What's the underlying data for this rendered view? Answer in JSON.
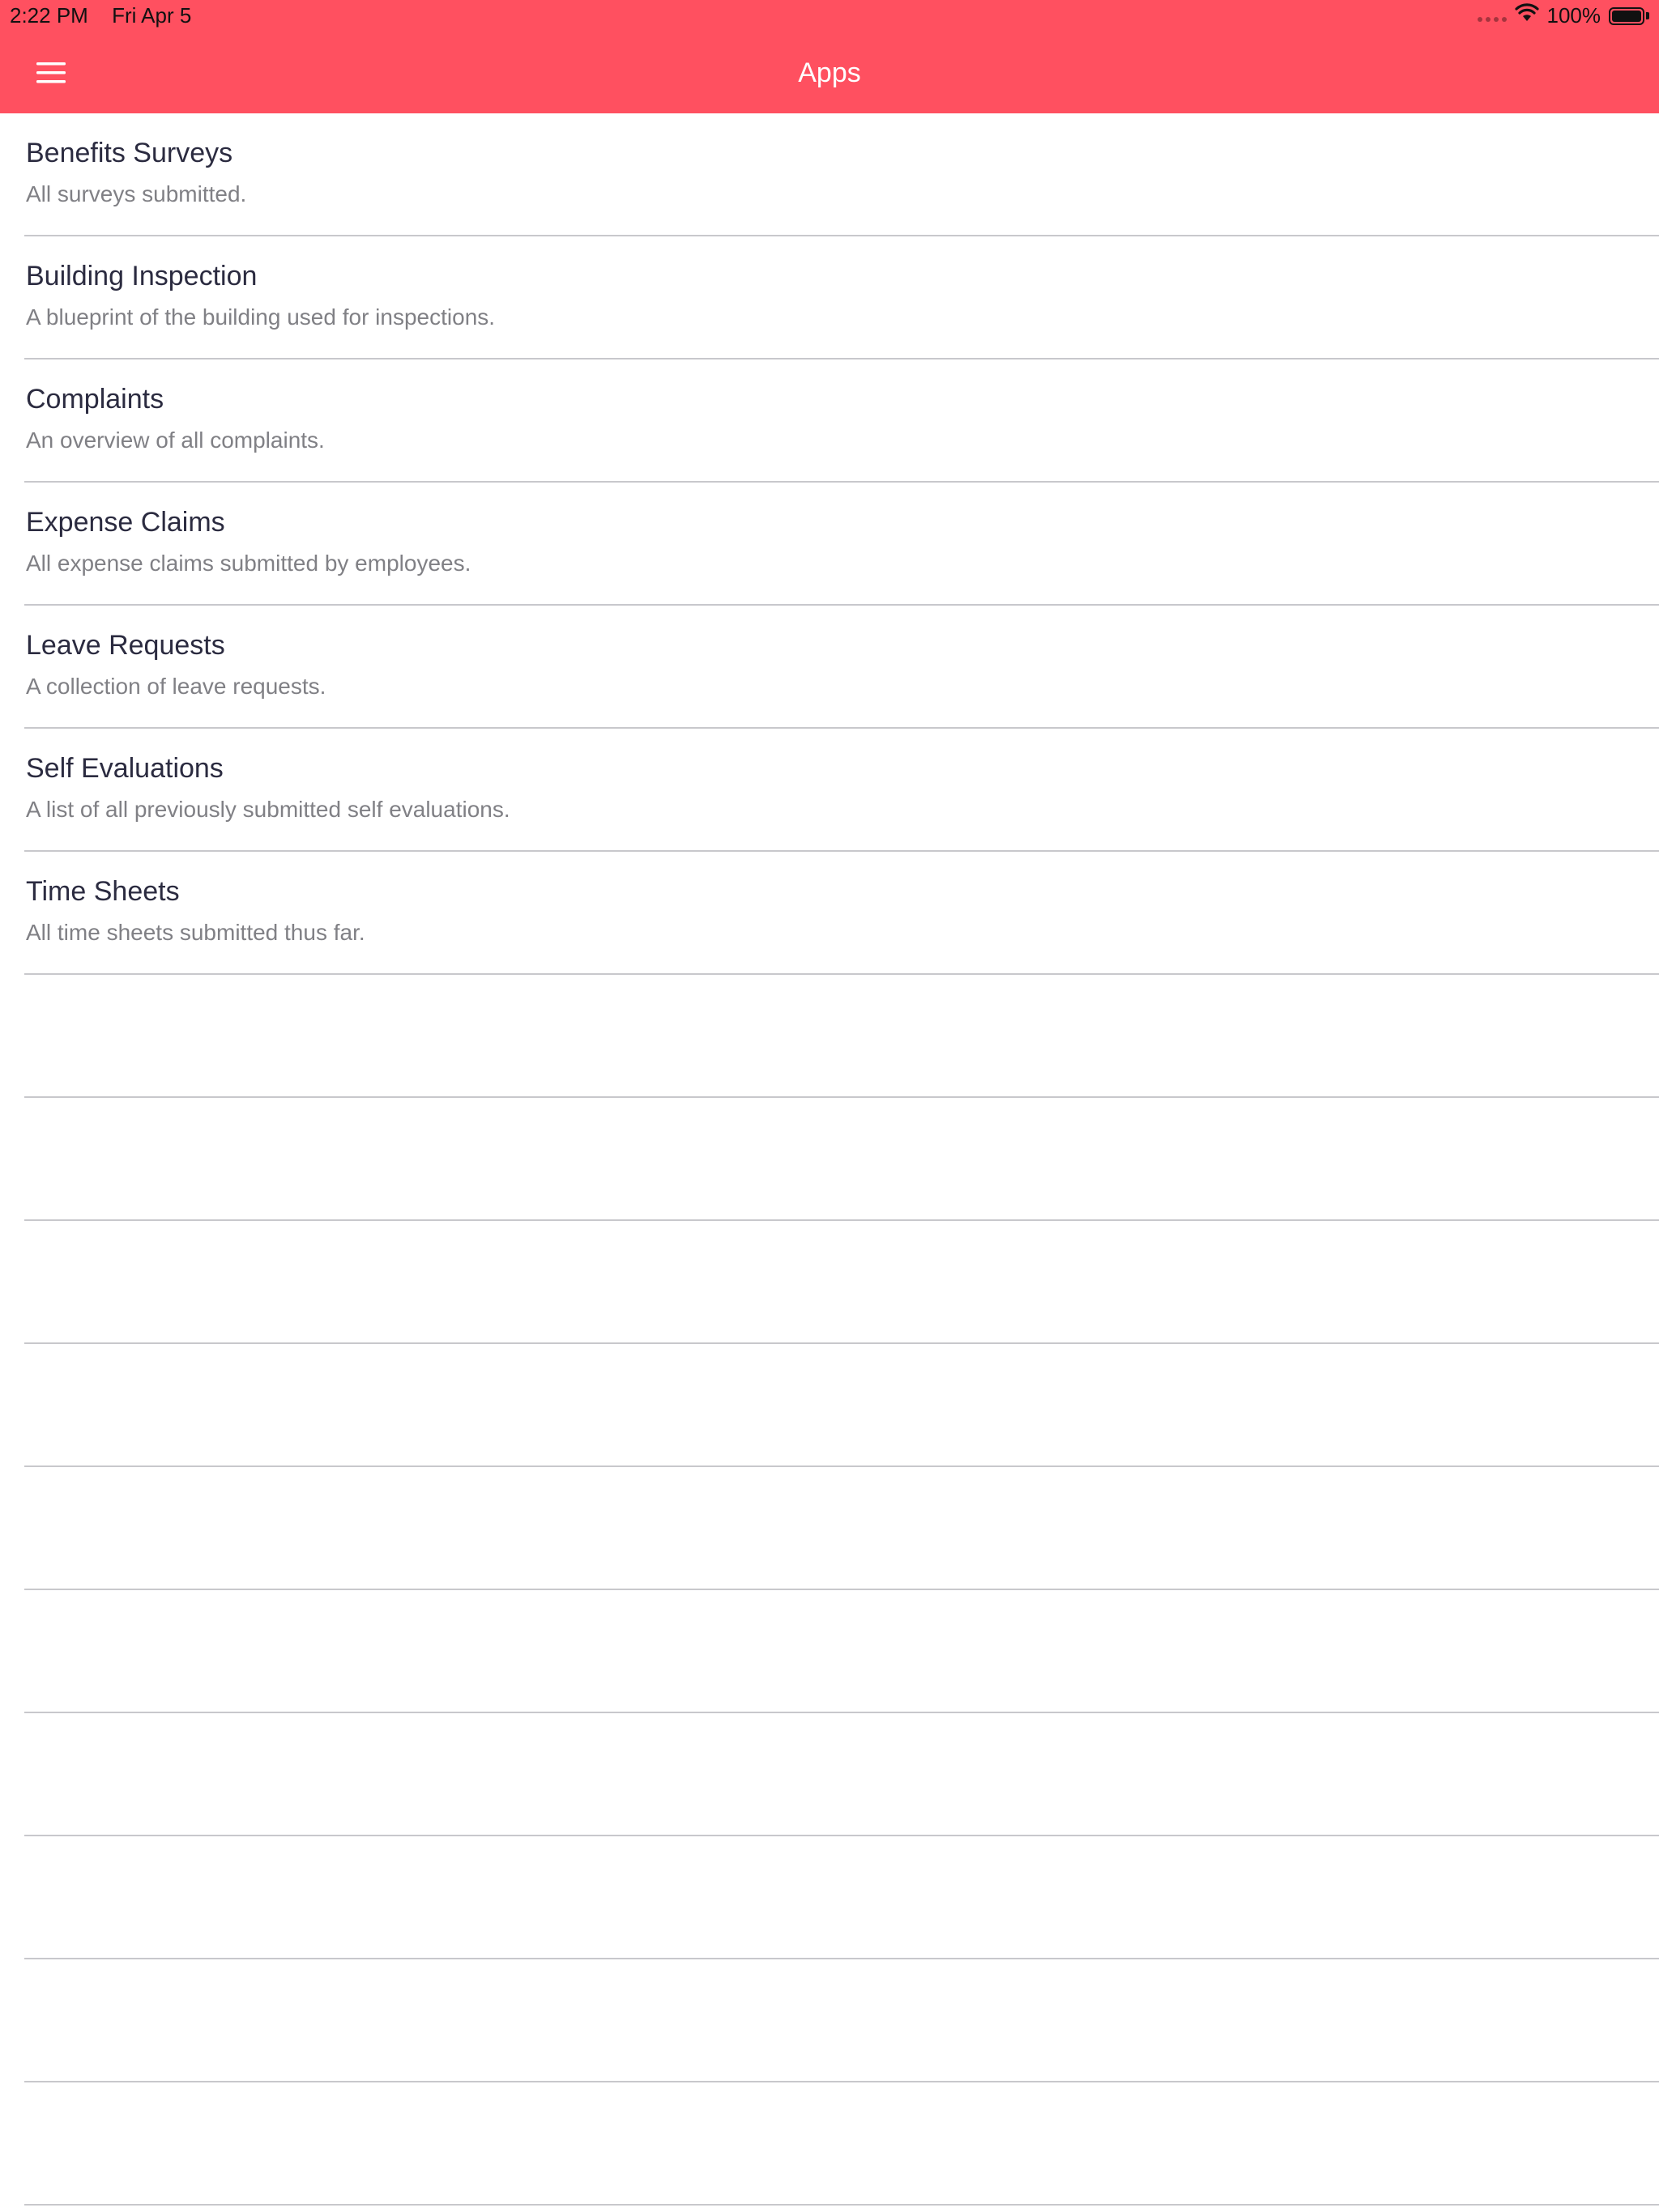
{
  "status_bar": {
    "time": "2:22 PM",
    "date": "Fri Apr 5",
    "battery": "100%",
    "battery_level": 1.0
  },
  "nav": {
    "title": "Apps",
    "menu_icon": "hamburger-menu-icon"
  },
  "theme": {
    "accent": "#ff5060",
    "title_text": "#2b2b40",
    "subtitle_text": "#808085",
    "separator": "#c8c8cc"
  },
  "apps": [
    {
      "title": "Benefits Surveys",
      "subtitle": "All surveys submitted."
    },
    {
      "title": "Building Inspection",
      "subtitle": "A blueprint of the building used for inspections."
    },
    {
      "title": "Complaints",
      "subtitle": "An overview of all complaints."
    },
    {
      "title": "Expense Claims",
      "subtitle": "All expense claims submitted by employees."
    },
    {
      "title": "Leave Requests",
      "subtitle": "A collection of leave requests."
    },
    {
      "title": "Self Evaluations",
      "subtitle": "A list of all previously submitted self evaluations."
    },
    {
      "title": "Time Sheets",
      "subtitle": "All time sheets submitted thus far."
    }
  ]
}
